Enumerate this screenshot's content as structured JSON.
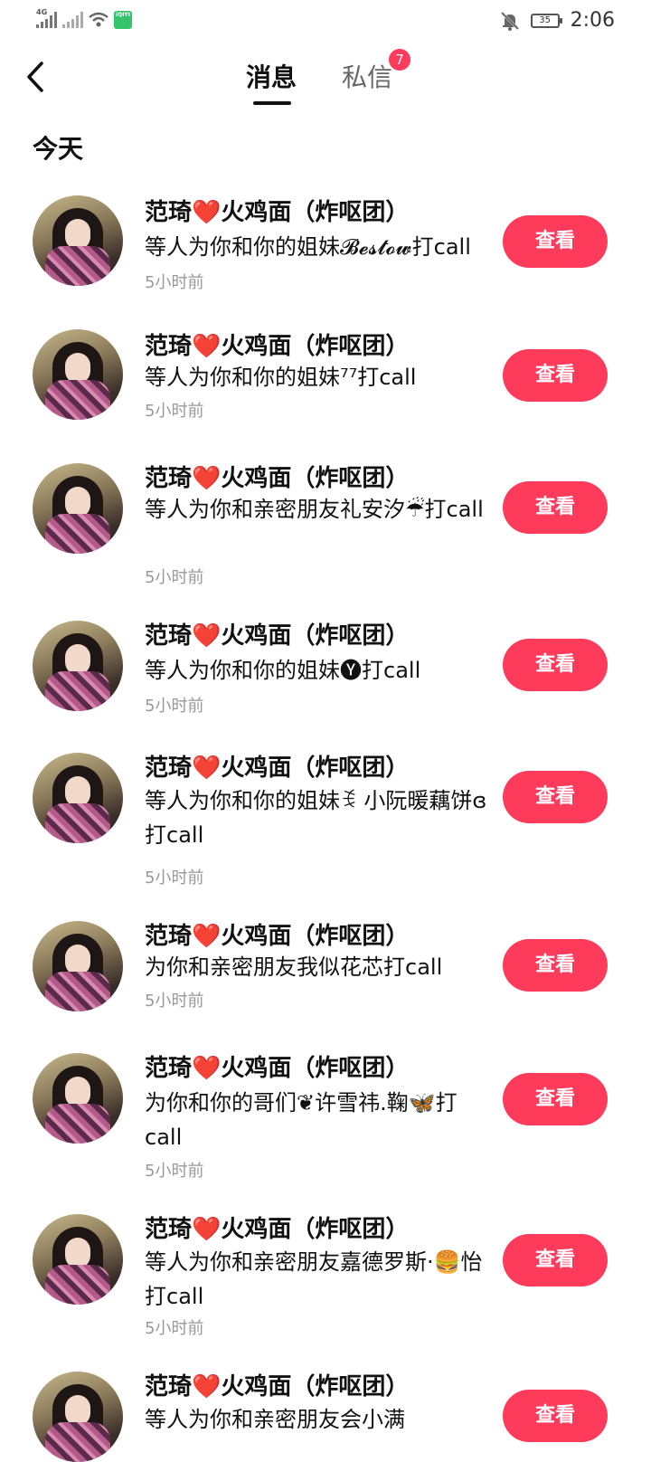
{
  "status_bar": {
    "network": "4G",
    "app_icon_label": "iQIYI",
    "battery": "35",
    "time": "2:06"
  },
  "header": {
    "back_icon": "chevron-left-icon",
    "tabs": [
      {
        "label": "消息",
        "active": true
      },
      {
        "label": "私信",
        "active": false,
        "badge": "7"
      }
    ]
  },
  "section": {
    "title": "今天"
  },
  "items": [
    {
      "name": "范琦❤️火鸡面（炸呕团）",
      "message": "等人为你和你的姐妹𝓑𝓮𝓼𝓽𝓸𝔀打call",
      "time": "5小时前",
      "button": "查看"
    },
    {
      "name": "范琦❤️火鸡面（炸呕团）",
      "message": "等人为你和你的姐妹⁷⁷打call",
      "time": "5小时前",
      "button": "查看"
    },
    {
      "name": "范琦❤️火鸡面（炸呕团）",
      "message": "等人为你和亲密朋友礼安汐☔打call",
      "time": "5小时前",
      "button": "查看"
    },
    {
      "name": "范琦❤️火鸡面（炸呕团）",
      "message": "等人为你和你的姐妹🅨打call",
      "time": "5小时前",
      "button": "查看"
    },
    {
      "name": "范琦❤️火鸡面（炸呕团）",
      "message": "等人为你和你的姐妹ꉂ 小阮暖藕饼ɞ打call",
      "time": "5小时前",
      "button": "查看"
    },
    {
      "name": "范琦❤️火鸡面（炸呕团）",
      "message": "为你和亲密朋友我似花芯打call",
      "time": "5小时前",
      "button": "查看"
    },
    {
      "name": "范琦❤️火鸡面（炸呕团）",
      "message": "为你和你的哥们❦许雪祎.鞠🦋打call",
      "time": "5小时前",
      "button": "查看"
    },
    {
      "name": "范琦❤️火鸡面（炸呕团）",
      "message": "等人为你和亲密朋友嘉德罗斯·🍔怡打call",
      "time": "5小时前",
      "button": "查看"
    },
    {
      "name": "范琦❤️火鸡面（炸呕团）",
      "message": "等人为你和亲密朋友会小满",
      "time": "",
      "button": "查看"
    }
  ]
}
